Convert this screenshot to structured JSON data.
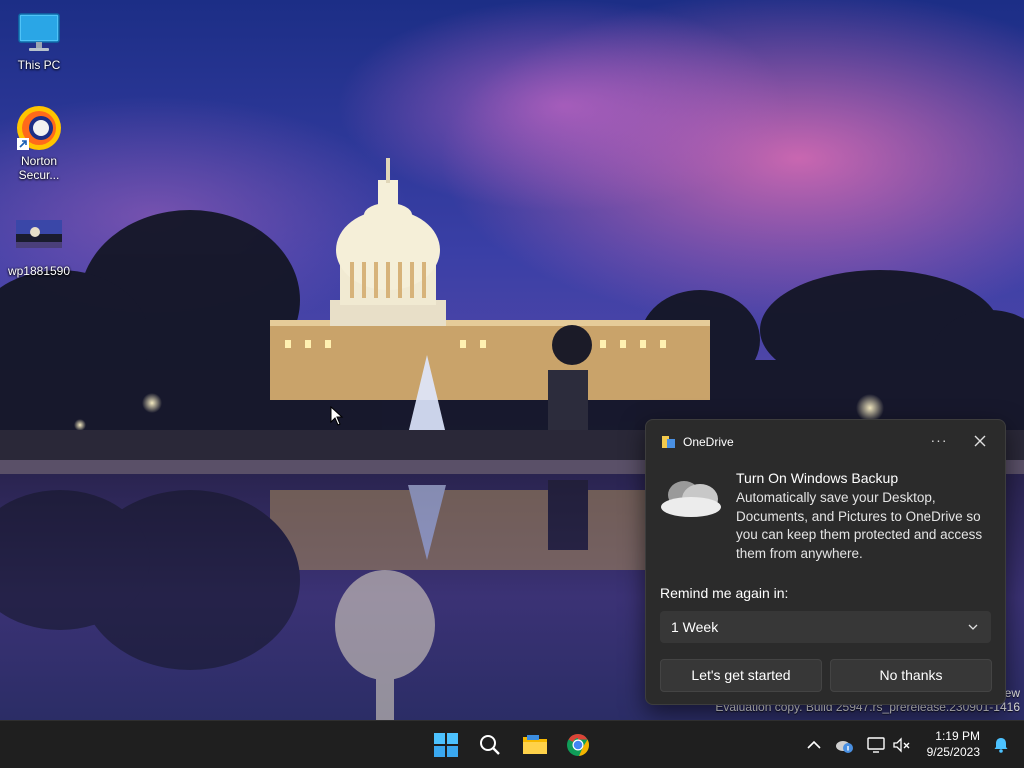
{
  "desktop": {
    "icons": [
      {
        "label": "This PC",
        "icon": "monitor-icon"
      },
      {
        "label": "Norton\nSecur...",
        "icon": "norton-icon"
      },
      {
        "label": "wp1881590",
        "icon": "image-thumbnail-icon"
      }
    ],
    "watermark": {
      "line1": "ew",
      "line2": "Evaluation copy. Build 25947.rs_prerelease.230901-1416"
    }
  },
  "notification": {
    "app_name": "OneDrive",
    "more_label": "···",
    "title": "Turn On Windows Backup",
    "body": "Automatically save your Desktop, Documents, and Pictures to OneDrive so you can keep them protected and access them from anywhere.",
    "remind_label": "Remind me again in:",
    "remind_selected": "1 Week",
    "primary_button": "Let's get started",
    "secondary_button": "No thanks",
    "icons": [
      "onedrive-icon",
      "more-icon",
      "close-icon",
      "cloud-icon",
      "chevron-down-icon"
    ]
  },
  "taskbar": {
    "apps": [
      "start-icon",
      "search-icon",
      "file-explorer-icon",
      "chrome-icon"
    ],
    "tray_icons": [
      "chevron-up-icon",
      "onedrive-tray-icon",
      "network-icon",
      "volume-muted-icon"
    ],
    "time": "1:19 PM",
    "date": "9/25/2023",
    "notification_icon": "bell-icon"
  },
  "colors": {
    "popup_bg": "#2b2b2b",
    "taskbar_bg": "#1f1f1f",
    "accent": "#4cc2ff",
    "chrome_red": "#db4437",
    "chrome_yellow": "#f4b400",
    "chrome_green": "#0f9d58",
    "chrome_blue": "#4285f4"
  }
}
